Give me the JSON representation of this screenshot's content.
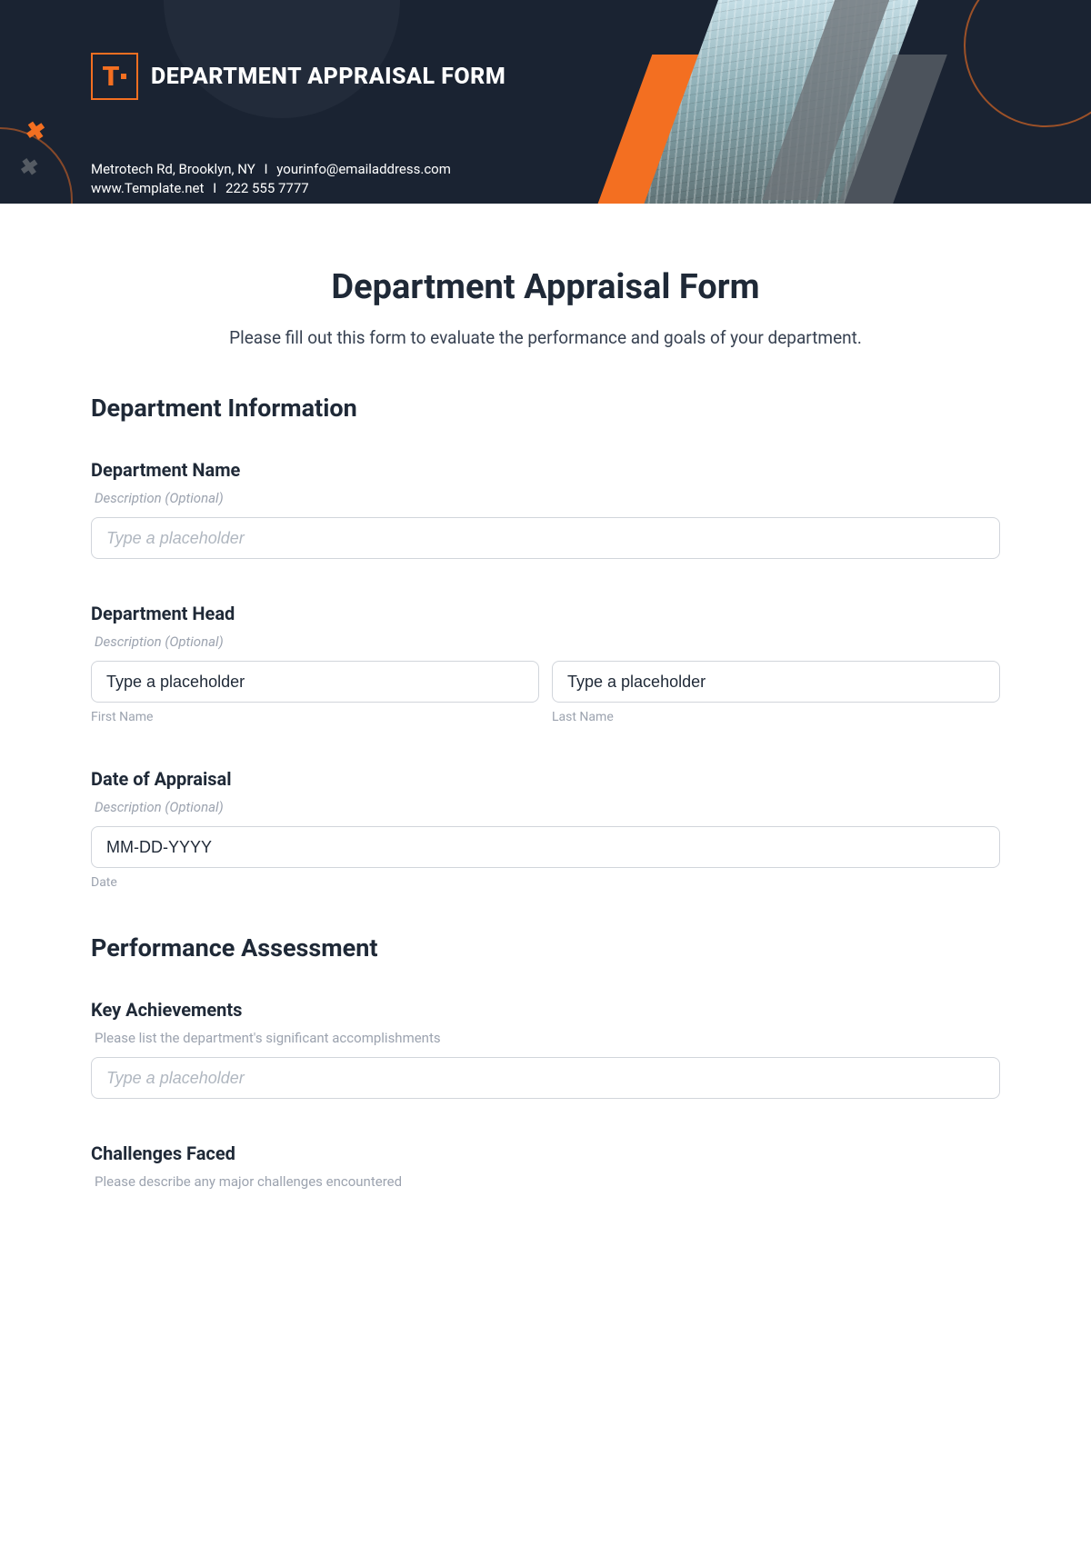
{
  "header": {
    "logo_text": "T",
    "title": "DEPARTMENT APPRAISAL FORM",
    "address": "Metrotech Rd, Brooklyn, NY",
    "email": "yourinfo@emailaddress.com",
    "website": "www.Template.net",
    "phone": "222 555 7777",
    "separator": "I"
  },
  "form": {
    "title": "Department Appraisal Form",
    "intro": "Please fill out this form to evaluate the performance and goals of your department.",
    "sections": {
      "dept_info": {
        "heading": "Department Information",
        "dept_name": {
          "label": "Department Name",
          "description": "Description (Optional)",
          "placeholder": "Type a placeholder"
        },
        "dept_head": {
          "label": "Department Head",
          "description": "Description (Optional)",
          "first_placeholder": "Type a placeholder",
          "last_placeholder": "Type a placeholder",
          "first_sublabel": "First Name",
          "last_sublabel": "Last Name"
        },
        "date": {
          "label": "Date of Appraisal",
          "description": "Description (Optional)",
          "placeholder": "MM-DD-YYYY",
          "sublabel": "Date"
        }
      },
      "perf": {
        "heading": "Performance Assessment",
        "achievements": {
          "label": "Key Achievements",
          "description": "Please list the department's significant accomplishments",
          "placeholder": "Type a placeholder"
        },
        "challenges": {
          "label": "Challenges Faced",
          "description": "Please describe any major challenges encountered"
        }
      }
    }
  }
}
